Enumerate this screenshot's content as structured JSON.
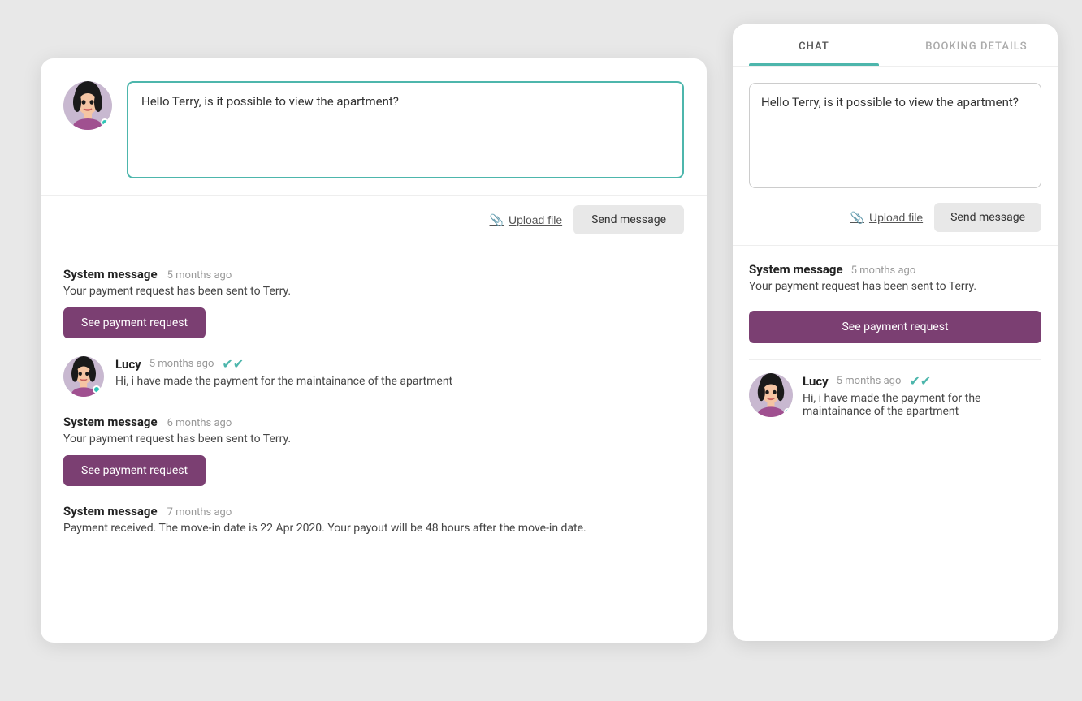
{
  "left": {
    "compose": {
      "placeholder": "Hello Terry, is it possible to view the apartment?",
      "upload_label": "Upload file",
      "send_label": "Send message"
    },
    "messages": [
      {
        "type": "system",
        "label": "System message",
        "time": "5 months ago",
        "text": "Your payment request has been sent to Terry.",
        "button": "See payment request"
      },
      {
        "type": "user",
        "username": "Lucy",
        "time": "5 months ago",
        "text": "Hi, i have made the payment for the maintainance of the apartment",
        "read": true
      },
      {
        "type": "system",
        "label": "System message",
        "time": "6 months ago",
        "text": "Your payment request has been sent to Terry.",
        "button": "See payment request"
      },
      {
        "type": "system",
        "label": "System message",
        "time": "7 months ago",
        "text": "Payment received. The move-in date is 22 Apr 2020. Your payout will be 48 hours after the move-in date.",
        "button": null
      }
    ]
  },
  "right": {
    "tabs": [
      {
        "label": "CHAT",
        "active": true
      },
      {
        "label": "BOOKING DETAILS",
        "active": false
      }
    ],
    "compose": {
      "text": "Hello Terry, is it possible to view the apartment?",
      "upload_label": "Upload file",
      "send_label": "Send message"
    },
    "messages": [
      {
        "type": "system",
        "label": "System message",
        "time": "5 months ago",
        "text": "Your payment request has been sent to Terry.",
        "button": "See payment request"
      },
      {
        "type": "user",
        "username": "Lucy",
        "time": "5 months ago",
        "text": "Hi, i have made the payment for the maintainance of the apartment",
        "read": true
      }
    ]
  },
  "colors": {
    "teal": "#4db6ac",
    "purple": "#7b3f72"
  }
}
